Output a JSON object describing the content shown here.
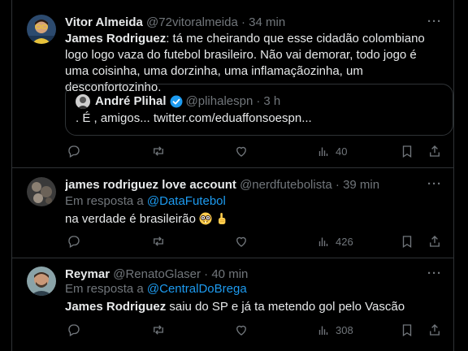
{
  "tweets": [
    {
      "name": "Vitor Almeida",
      "handle": "@72vitoralmeida",
      "sep": "·",
      "time": "34 min",
      "more": "···",
      "text_bold": "James Rodriguez",
      "text_rest": ": tá me cheirando que esse cidadão colombiano logo logo vaza do futebol brasileiro. Não vai demorar, todo jogo é uma coisinha, uma dorzinha, uma inflamaçãozinha, um desconfortozinho.",
      "views": "40",
      "quote": {
        "name": "André Plihal",
        "handle": "@plihalespn",
        "sep": "·",
        "time": "3 h",
        "text": ". É , amigos... twitter.com/eduaffonsoespn..."
      }
    },
    {
      "name": "james rodriguez love account",
      "handle": "@nerdfutebolista",
      "sep": "·",
      "time": "39 min",
      "more": "···",
      "reply_prefix": "Em resposta a",
      "reply_to": "@DataFutebol",
      "text": "na verdade é brasileirão",
      "views": "426"
    },
    {
      "name": "Reymar",
      "handle": "@RenatoGlaser",
      "sep": "·",
      "time": "40 min",
      "more": "···",
      "reply_prefix": "Em resposta a",
      "reply_to": "@CentralDoBrega",
      "text_bold": "James Rodriguez",
      "text_rest": " saiu do SP e já ta metendo gol pelo Vascão",
      "views": "308"
    }
  ],
  "icons": [
    "reply-icon",
    "retweet-icon",
    "like-icon",
    "views-icon",
    "bookmark-icon",
    "share-icon",
    "verified-icon",
    "nerd-face-emoji",
    "pointing-up-emoji"
  ],
  "colors": {
    "background": "#000000",
    "text": "#e7e9ea",
    "muted": "#71767b",
    "link": "#1d9bf0",
    "border": "#2f3336"
  }
}
